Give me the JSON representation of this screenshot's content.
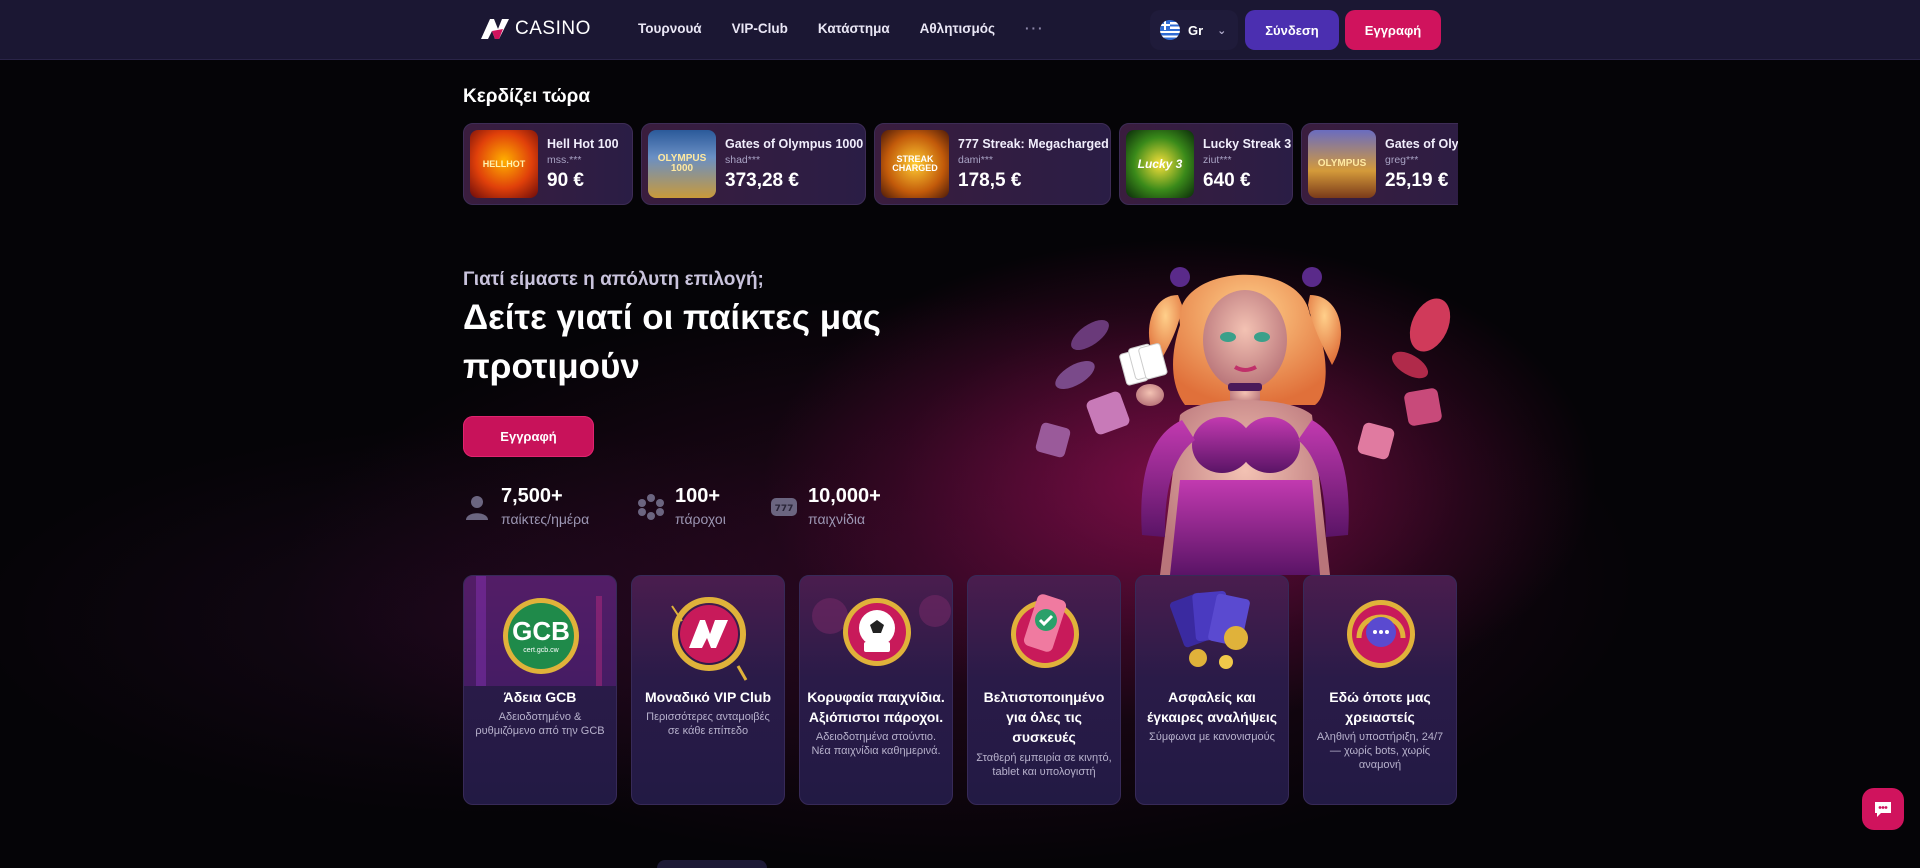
{
  "header": {
    "logo_text": "CASINO",
    "nav": [
      "Τουρνουά",
      "VIP-Club",
      "Κατάστημα",
      "Αθλητισμός"
    ],
    "more": "···",
    "language": "Gr",
    "login_label": "Σύνδεση",
    "register_label": "Εγγραφή"
  },
  "winners": {
    "title": "Κερδίζει τώρα",
    "items": [
      {
        "game": "Hell Hot 100",
        "user": "mss.***",
        "amount": "90 €",
        "thumb_text": "HELLHOT"
      },
      {
        "game": "Gates of Olympus 1000",
        "user": "shad***",
        "amount": "373,28 €",
        "thumb_text": "OLYMPUS 1000"
      },
      {
        "game": "777 Streak: Megacharged",
        "user": "dami***",
        "amount": "178,5 €",
        "thumb_text": "STREAK CHARGED"
      },
      {
        "game": "Lucky Streak 3",
        "user": "ziut***",
        "amount": "640 €",
        "thumb_text": "Lucky 3"
      },
      {
        "game": "Gates of Olympus",
        "user": "greg***",
        "amount": "25,19 €",
        "thumb_text": "OLYMPUS"
      }
    ]
  },
  "hero": {
    "subtitle": "Γιατί είμαστε η απόλυτη επιλογή;",
    "title": "Δείτε γιατί οι παίκτες μας προτιμούν",
    "button": "Εγγραφή",
    "stats": [
      {
        "value": "7,500+",
        "label": "παίκτες/ημέρα",
        "icon": "user-icon"
      },
      {
        "value": "100+",
        "label": "πάροχοι",
        "icon": "providers-icon"
      },
      {
        "value": "10,000+",
        "label": "παιχνίδια",
        "icon": "slot-icon"
      }
    ]
  },
  "features": [
    {
      "title": "Άδεια GCB",
      "desc": "Αδειοδοτημένο & ρυθμιζόμενο από την GCB",
      "badge": "GCB",
      "badge_sub": "cert.gcb.cw"
    },
    {
      "title": "Μοναδικό VIP Club",
      "desc": "Περισσότερες ανταμοιβές σε κάθε επίπεδο"
    },
    {
      "title": "Κορυφαία παιχνίδια. Αξιόπιστοι πάροχοι.",
      "desc": "Αδειοδοτημένα στούντιο. Νέα παιχνίδια καθημερινά."
    },
    {
      "title": "Βελτιστοποιημένο για όλες τις συσκευές",
      "desc": "Σταθερή εμπειρία σε κινητό, tablet και υπολογιστή"
    },
    {
      "title": "Ασφαλείς και έγκαιρες αναλήψεις",
      "desc": "Σύμφωνα με κανονισμούς"
    },
    {
      "title": "Εδώ όποτε μας χρειαστείς",
      "desc": "Αληθινή υποστήριξη, 24/7 — χωρίς bots, χωρίς αναμονή"
    }
  ],
  "colors": {
    "accent": "#d0135d",
    "login": "#4b2fb0",
    "header": "#1b1733"
  }
}
